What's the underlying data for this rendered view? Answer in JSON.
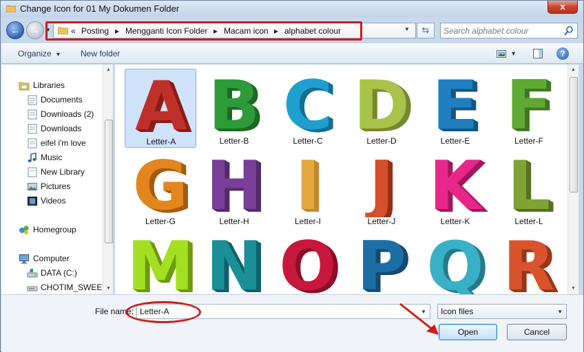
{
  "window": {
    "title": "Change Icon for 01 My Dokumen Folder",
    "close_label": "x"
  },
  "nav": {
    "back_glyph": "←",
    "forward_glyph": "→",
    "recent_glyph": "▼",
    "breadcrumb_lead": "«",
    "breadcrumb_sep": "▸",
    "breadcrumb": [
      "Posting",
      "Mengganti Icon Folder",
      "Macam icon",
      "alphabet colour"
    ],
    "address_drop_glyph": "▼",
    "refresh_glyph": "⇆",
    "search_placeholder": "Search alphabet colour"
  },
  "toolbar": {
    "organize_label": "Organize",
    "organize_caret": "▾",
    "new_folder_label": "New folder",
    "views_caret": "▾",
    "help_glyph": "?"
  },
  "sidebar": {
    "items": [
      {
        "label": "Libraries",
        "icon": "libraries-icon"
      },
      {
        "label": "Documents",
        "icon": "documents-icon"
      },
      {
        "label": "Downloads (2)",
        "icon": "documents-icon"
      },
      {
        "label": "Downloads",
        "icon": "documents-icon"
      },
      {
        "label": "eifel i'm love",
        "icon": "documents-icon"
      },
      {
        "label": "Music",
        "icon": "music-icon"
      },
      {
        "label": "New Library",
        "icon": "documents-icon"
      },
      {
        "label": "Pictures",
        "icon": "pictures-icon"
      },
      {
        "label": "Videos",
        "icon": "videos-icon"
      },
      {
        "label": "Homegroup",
        "icon": "homegroup-icon"
      },
      {
        "label": "Computer",
        "icon": "computer-icon"
      },
      {
        "label": "DATA (C:)",
        "icon": "drive-icon"
      },
      {
        "label": "CHOTIM_SWEET",
        "icon": "removable-drive-icon"
      }
    ]
  },
  "files": [
    {
      "label": "Letter-A",
      "letter": "A",
      "color": "#c0302a",
      "shade": "#8a1d18"
    },
    {
      "label": "Letter-B",
      "letter": "B",
      "color": "#2e9b3a",
      "shade": "#1d6a25"
    },
    {
      "label": "Letter-C",
      "letter": "C",
      "color": "#1ea0cf",
      "shade": "#146f91"
    },
    {
      "label": "Letter-D",
      "letter": "D",
      "color": "#a9c24a",
      "shade": "#76882f"
    },
    {
      "label": "Letter-E",
      "letter": "E",
      "color": "#1f7fbf",
      "shade": "#135685"
    },
    {
      "label": "Letter-F",
      "letter": "F",
      "color": "#5fa935",
      "shade": "#3f7622"
    },
    {
      "label": "Letter-G",
      "letter": "G",
      "color": "#e3861e",
      "shade": "#a35c10"
    },
    {
      "label": "Letter-H",
      "letter": "H",
      "color": "#7a3f98",
      "shade": "#532a69"
    },
    {
      "label": "Letter-I",
      "letter": "I",
      "color": "#e3a83e",
      "shade": "#c4872a"
    },
    {
      "label": "Letter-J",
      "letter": "J",
      "color": "#d64f2c",
      "shade": "#962f16"
    },
    {
      "label": "Letter-K",
      "letter": "K",
      "color": "#e8278a",
      "shade": "#a1165d"
    },
    {
      "label": "Letter-L",
      "letter": "L",
      "color": "#7fa336",
      "shade": "#56701f"
    },
    {
      "label": "",
      "letter": "M",
      "color": "#a4e022",
      "shade": "#6c9a10"
    },
    {
      "label": "",
      "letter": "N",
      "color": "#1a8f98",
      "shade": "#11616a"
    },
    {
      "label": "",
      "letter": "O",
      "color": "#c8173c",
      "shade": "#8a0f28"
    },
    {
      "label": "",
      "letter": "P",
      "color": "#1d6ea7",
      "shade": "#134a72"
    },
    {
      "label": "",
      "letter": "Q",
      "color": "#3ab0c6",
      "shade": "#257a8b"
    },
    {
      "label": "",
      "letter": "R",
      "color": "#d9542c",
      "shade": "#9a3617"
    }
  ],
  "footer": {
    "file_name_label": "File name:",
    "file_name_value": "Letter-A",
    "file_drop_glyph": "▼",
    "file_type": "Icon files",
    "type_caret": "▼",
    "open_label": "Open",
    "cancel_label": "Cancel"
  },
  "colors": {
    "annotation_red": "#d21b1b",
    "selection": "#cfe3fb"
  }
}
